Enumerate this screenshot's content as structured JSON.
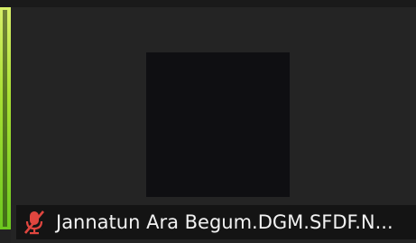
{
  "participant": {
    "display_name": "Jannatun Ara Begum.DGM.SFDF.N...",
    "mic_status_icon": "mic-muted-icon",
    "is_active_speaker": true
  },
  "colors": {
    "active_border": "#a9e034",
    "muted_icon": "#e0463f",
    "tile_background": "#242424",
    "avatar_background": "#0f0f12",
    "name_bar_background": "#141414",
    "name_text": "#f2f2f2"
  }
}
